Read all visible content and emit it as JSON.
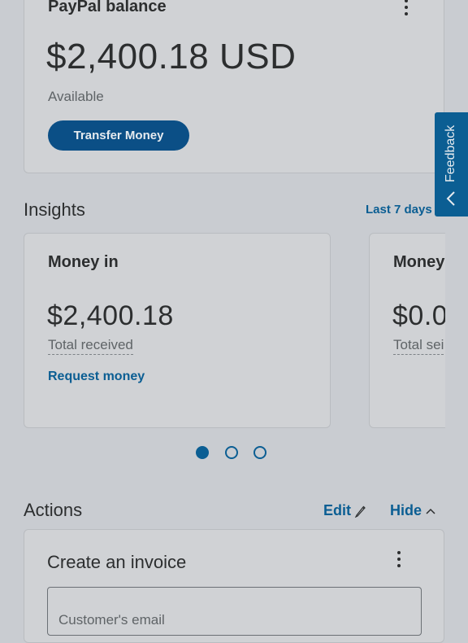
{
  "balance": {
    "title": "PayPal balance",
    "amount": "$2,400.18 USD",
    "status": "Available",
    "transfer_label": "Transfer Money"
  },
  "feedback": {
    "label": "Feedback"
  },
  "insights": {
    "title": "Insights",
    "period_label": "Last 7 days",
    "cards": [
      {
        "title": "Money in",
        "amount": "$2,400.18",
        "subtitle": "Total received",
        "link": "Request money"
      },
      {
        "title": "Money",
        "amount": "$0.0",
        "subtitle": "Total sei"
      }
    ],
    "carousel": {
      "page_count": 3,
      "active_index": 0
    }
  },
  "actions": {
    "title": "Actions",
    "edit_label": "Edit",
    "hide_label": "Hide"
  },
  "invoice": {
    "title": "Create an invoice",
    "email_placeholder": "Customer's email"
  },
  "colors": {
    "accent": "#0b5e93",
    "button": "#0b4f86",
    "background": "#c9ccd1"
  }
}
